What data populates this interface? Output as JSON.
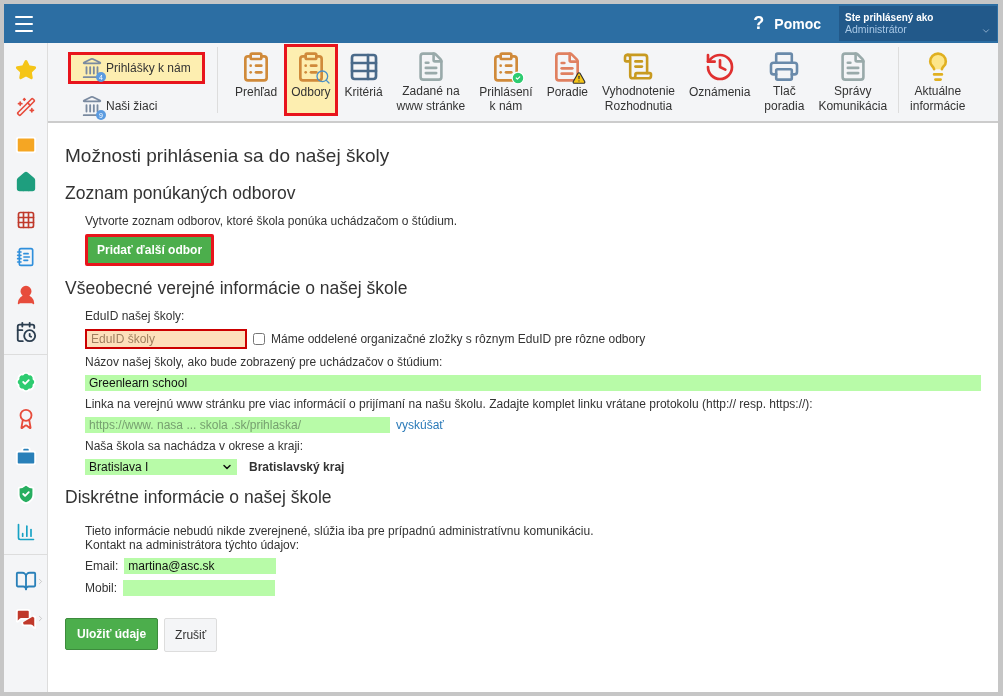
{
  "header": {
    "help": "Pomoc",
    "help_mark": "?",
    "user_caption": "Ste prihlásený ako",
    "user_name": "Administrátor"
  },
  "modules": [
    {
      "label": "Prihlášky k nám",
      "badge": "4",
      "selected": true,
      "highlighted": true
    },
    {
      "label": "Naši žiaci",
      "badge": "9",
      "selected": false,
      "highlighted": false
    }
  ],
  "toolbar": [
    {
      "label": "Prehľad",
      "selected": false,
      "highlighted": false
    },
    {
      "label": "Odbory",
      "selected": true,
      "highlighted": true
    },
    {
      "label": "Kritériá",
      "selected": false,
      "highlighted": false
    },
    {
      "label": "Zadané na\nwww stránke",
      "selected": false,
      "highlighted": false
    },
    {
      "label": "Prihlásení\nk nám",
      "selected": false,
      "highlighted": false
    },
    {
      "label": "Poradie",
      "selected": false,
      "highlighted": false
    },
    {
      "label": "Vyhodnotenie\nRozhodnutia",
      "selected": false,
      "highlighted": false
    },
    {
      "label": "Oznámenia",
      "selected": false,
      "highlighted": false
    },
    {
      "label": "Tlač\nporadia",
      "selected": false,
      "highlighted": false
    },
    {
      "label": "Správy\nKomunikácia",
      "selected": false,
      "highlighted": false
    },
    {
      "label": "Aktuálne\ninformácie",
      "selected": false,
      "highlighted": false
    }
  ],
  "page_title": "Možnosti prihlásenia sa do našej školy",
  "programs": {
    "heading": "Zoznam ponúkaných odborov",
    "text": "Vytvorte zoznam odborov, ktoré škola ponúka uchádzačom o štúdium.",
    "button": "Pridať ďalší odbor",
    "highlighted": true
  },
  "public": {
    "heading": "Všeobecné verejné informácie o našej škole",
    "eduid_label": "EduID našej školy:",
    "eduid_placeholder": "EduID školy",
    "eduid_invalid": true,
    "separate_checkbox": {
      "label": "Máme oddelené organizačné zložky s rôznym EduID pre rôzne odbory",
      "checked": false
    },
    "name_label": "Názov našej školy, ako bude zobrazený pre uchádzačov o štúdium:",
    "name_value": "Greenlearn school",
    "link_label": "Linka na verejnú www stránku pre viac informácií o prijímaní na našu školu. Zadajte komplet linku vrátane protokolu (http:// resp. https://):",
    "link_placeholder": "https://www. nasa ... skola .sk/prihlaska/",
    "link_test": "vyskúšať",
    "district_label": "Naša škola sa nachádza v okrese a kraji:",
    "district_value": "Bratislava I",
    "region": "Bratislavský kraj"
  },
  "private": {
    "heading": "Diskrétne informácie o našej škole",
    "text": "Tieto informácie nebudú nikde zverejnené, slúžia iba pre prípadnú administratívnu komunikáciu.\nKontakt na administrátora týchto údajov:",
    "email_label": "Email:",
    "email_value": "martina@asc.sk",
    "mobile_label": "Mobil:"
  },
  "buttons": {
    "save": "Uložiť údaje",
    "cancel": "Zrušiť"
  }
}
